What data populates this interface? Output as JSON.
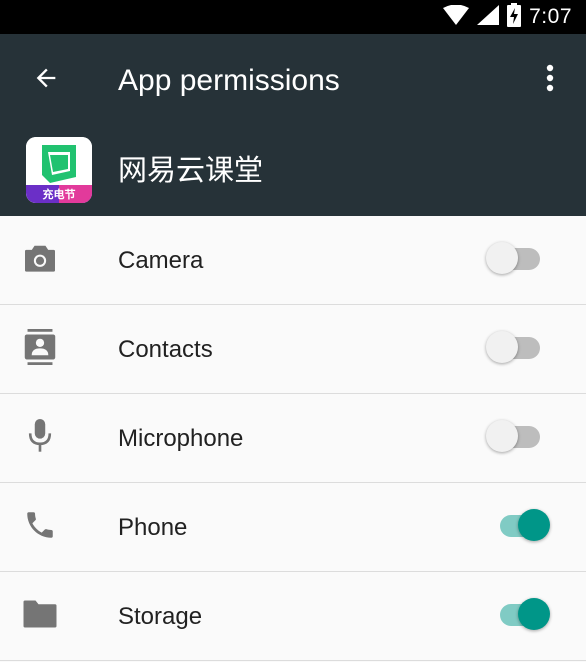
{
  "status_bar": {
    "time": "7:07"
  },
  "app_bar": {
    "title": "App permissions",
    "back_icon": "arrow-back-icon",
    "menu_icon": "more-vert-icon"
  },
  "app_header": {
    "app_name": "网易云课堂",
    "icon_badge": "充电节"
  },
  "colors": {
    "primary": "#263238",
    "accent": "#009688",
    "accent_light": "#80cbc4"
  },
  "permissions": [
    {
      "label": "Camera",
      "icon": "camera-icon",
      "enabled": false
    },
    {
      "label": "Contacts",
      "icon": "contacts-icon",
      "enabled": false
    },
    {
      "label": "Microphone",
      "icon": "microphone-icon",
      "enabled": false
    },
    {
      "label": "Phone",
      "icon": "phone-icon",
      "enabled": true
    },
    {
      "label": "Storage",
      "icon": "folder-icon",
      "enabled": true
    }
  ]
}
